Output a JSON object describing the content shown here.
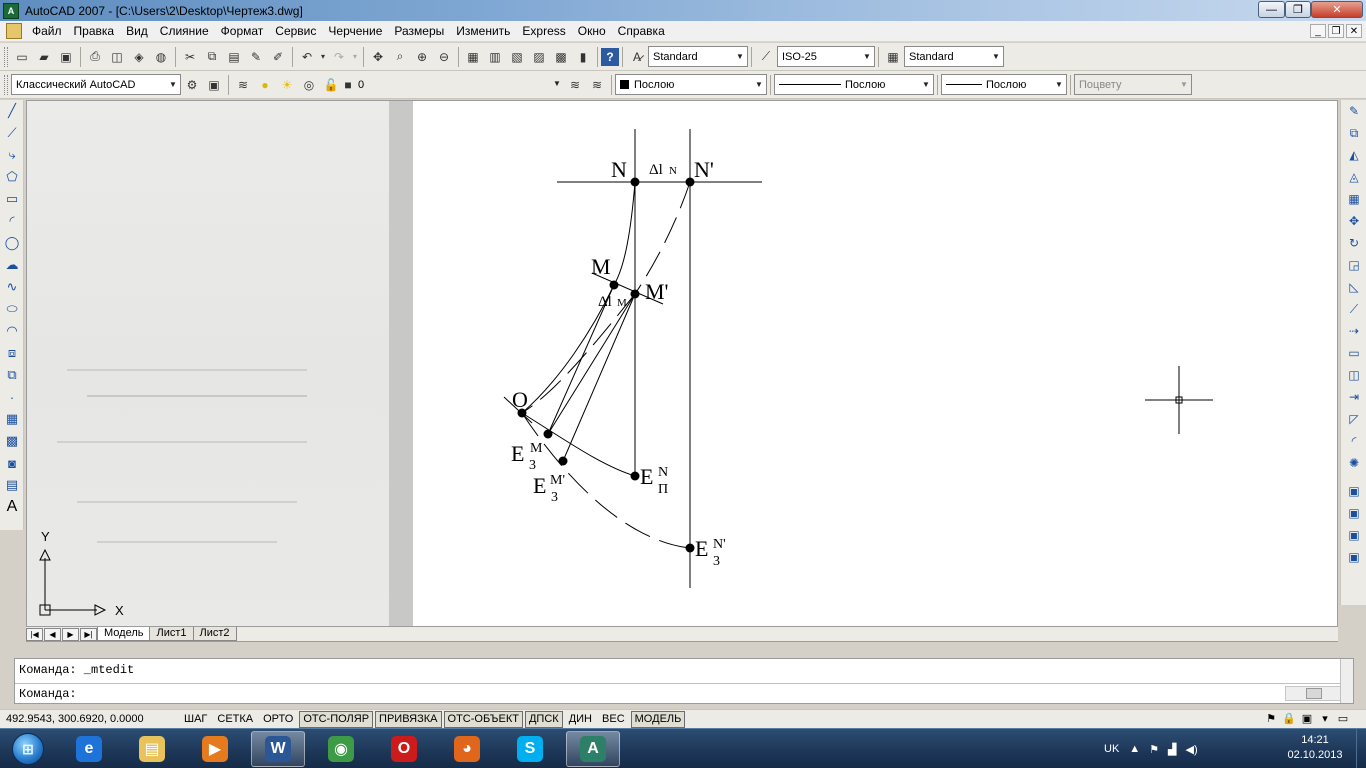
{
  "window": {
    "app_icon": "A",
    "title": "AutoCAD 2007 - [C:\\Users\\2\\Desktop\\Чертеж3.dwg]",
    "min_glyph": "—",
    "max_glyph": "❐",
    "close_glyph": "✕"
  },
  "menu": {
    "items": [
      "Файл",
      "Правка",
      "Вид",
      "Слияние",
      "Формат",
      "Сервис",
      "Черчение",
      "Размеры",
      "Изменить",
      "Express",
      "Окно",
      "Справка"
    ],
    "doc_min": "_",
    "doc_restore": "❐",
    "doc_close": "✕"
  },
  "toolbar1": {
    "text_style": "Standard",
    "dim_style": "ISO-25",
    "table_style": "Standard"
  },
  "toolbar2": {
    "workspace": "Классический AutoCAD",
    "layer": "0",
    "color": "Послою",
    "linetype": "Послою",
    "lineweight": "Послою",
    "plotstyle": "Поцвету"
  },
  "drawing": {
    "labels": {
      "N": "N",
      "N_prime": "N'",
      "delta_N": "Δl",
      "delta_N_sub": "N",
      "M": "M",
      "M_prime": "M'",
      "delta_M": "Δl",
      "delta_M_sub": "M",
      "O": "O",
      "E": "E",
      "sub_3": "3",
      "sub_P": "П",
      "sup_M": "M",
      "sup_M_prime": "M'",
      "sup_N": "N",
      "sup_N_prime": "N'"
    },
    "ucs": {
      "x": "X",
      "y": "Y"
    }
  },
  "layout_tabs": {
    "nav": [
      "|◀",
      "◀",
      "▶",
      "▶|"
    ],
    "tabs": [
      "Модель",
      "Лист1",
      "Лист2"
    ],
    "active": 0
  },
  "command": {
    "line1": "Команда:  _mtedit",
    "prompt": "Команда:"
  },
  "status": {
    "coords": "492.9543, 300.6920, 0.0000",
    "buttons": [
      {
        "label": "ШАГ",
        "on": false
      },
      {
        "label": "СЕТКА",
        "on": false
      },
      {
        "label": "ОРТО",
        "on": false
      },
      {
        "label": "ОТС-ПОЛЯР",
        "on": true
      },
      {
        "label": "ПРИВЯЗКА",
        "on": true
      },
      {
        "label": "ОТС-ОБЪЕКТ",
        "on": true
      },
      {
        "label": "ДПСК",
        "on": true
      },
      {
        "label": "ДИН",
        "on": false
      },
      {
        "label": "ВЕС",
        "on": false
      },
      {
        "label": "МОДЕЛЬ",
        "on": true
      }
    ]
  },
  "taskbar": {
    "tasks": [
      {
        "name": "ie",
        "glyph": "e",
        "color": "#1e73d8",
        "active": false
      },
      {
        "name": "explorer",
        "glyph": "▤",
        "color": "#e8c25a",
        "active": false
      },
      {
        "name": "media",
        "glyph": "▶",
        "color": "#e57a1f",
        "active": false
      },
      {
        "name": "word",
        "glyph": "W",
        "color": "#2b5797",
        "active": true
      },
      {
        "name": "chrome",
        "glyph": "◉",
        "color": "#3d9b45",
        "active": false
      },
      {
        "name": "opera",
        "glyph": "O",
        "color": "#cc1b1b",
        "active": false
      },
      {
        "name": "firefox",
        "glyph": "◕",
        "color": "#e0661c",
        "active": false
      },
      {
        "name": "skype",
        "glyph": "S",
        "color": "#00aff0",
        "active": false
      },
      {
        "name": "autocad",
        "glyph": "A",
        "color": "#2d7f67",
        "active": true
      }
    ],
    "lang": "UK",
    "time": "14:21",
    "date": "02.10.2013"
  }
}
